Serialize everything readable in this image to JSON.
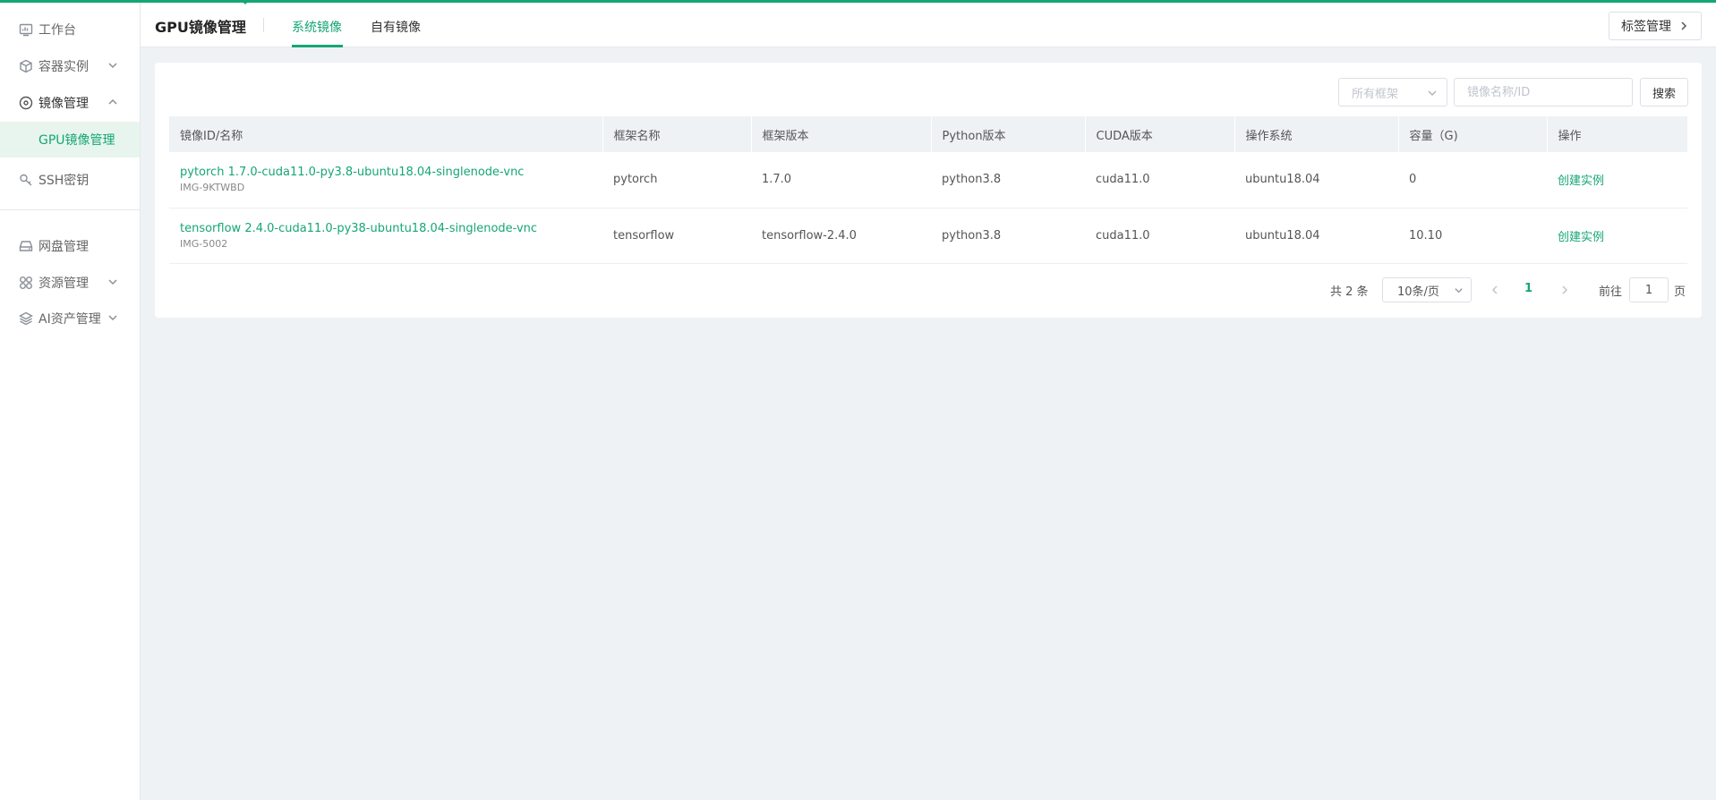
{
  "sidebar": {
    "items": [
      {
        "label": "工作台",
        "icon": "dashboard-icon"
      },
      {
        "label": "容器实例",
        "icon": "cube-icon",
        "expandable": true
      },
      {
        "label": "镜像管理",
        "icon": "disc-icon",
        "expandable": true,
        "open": true
      },
      {
        "label": "SSH密钥",
        "icon": "key-icon"
      },
      {
        "label": "网盘管理",
        "icon": "drive-icon"
      },
      {
        "label": "资源管理",
        "icon": "grid-icon",
        "expandable": true
      },
      {
        "label": "AI资产管理",
        "icon": "layers-icon",
        "expandable": true
      }
    ],
    "sub_active": "GPU镜像管理"
  },
  "header": {
    "title": "GPU镜像管理",
    "tabs": [
      {
        "label": "系统镜像",
        "active": true
      },
      {
        "label": "自有镜像",
        "active": false
      }
    ],
    "tag_button": "标签管理"
  },
  "filters": {
    "framework_placeholder": "所有框架",
    "search_placeholder": "镜像名称/ID",
    "search_button": "搜索"
  },
  "table": {
    "columns": [
      "镜像ID/名称",
      "框架名称",
      "框架版本",
      "Python版本",
      "CUDA版本",
      "操作系统",
      "容量（G)",
      "操作"
    ],
    "rows": [
      {
        "name": "pytorch 1.7.0-cuda11.0-py3.8-ubuntu18.04-singlenode-vnc",
        "id": "IMG-9KTWBD",
        "framework": "pytorch",
        "framework_version": "1.7.0",
        "python": "python3.8",
        "cuda": "cuda11.0",
        "os": "ubuntu18.04",
        "capacity": "0",
        "action": "创建实例"
      },
      {
        "name": "tensorflow 2.4.0-cuda11.0-py38-ubuntu18.04-singlenode-vnc",
        "id": "IMG-5002",
        "framework": "tensorflow",
        "framework_version": "tensorflow-2.4.0",
        "python": "python3.8",
        "cuda": "cuda11.0",
        "os": "ubuntu18.04",
        "capacity": "10.10",
        "action": "创建实例"
      }
    ]
  },
  "pagination": {
    "total": "共 2 条",
    "page_size": "10条/页",
    "current_page": "1",
    "goto_label": "前往",
    "goto_value": "1",
    "page_suffix": "页"
  },
  "colors": {
    "accent": "#15a675",
    "background": "#eff2f5",
    "sidebar_active_bg": "#e8f5ef"
  }
}
